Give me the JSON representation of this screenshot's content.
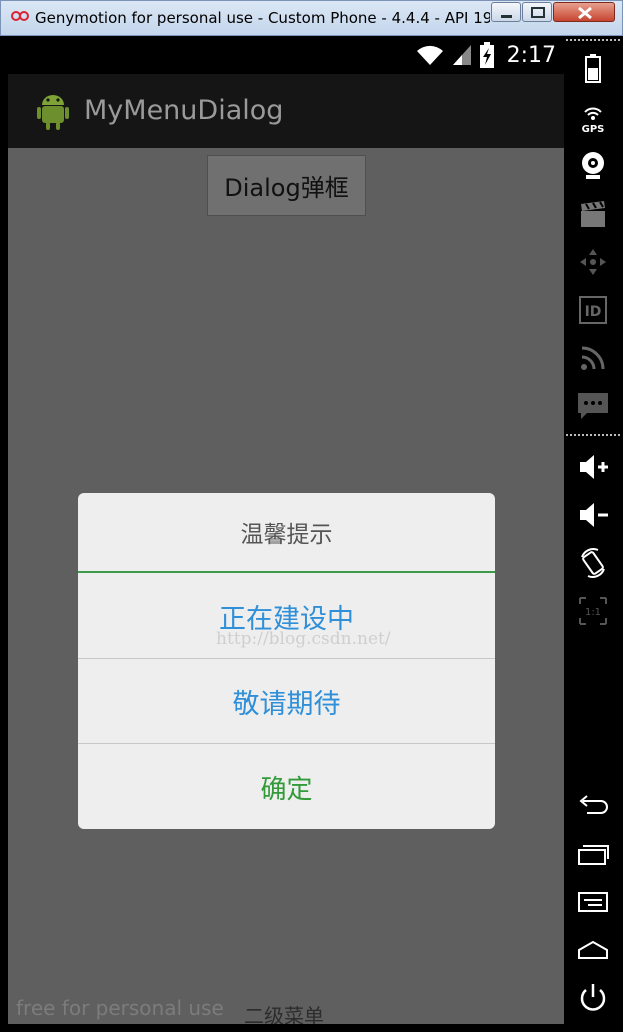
{
  "window": {
    "title": "Genymotion for personal use - Custom Phone - 4.4.4 - API 19 ..."
  },
  "status_bar": {
    "time": "2:17"
  },
  "app": {
    "title": "MyMenuDialog"
  },
  "content": {
    "trigger_button_label": "Dialog弹框",
    "bottom_hint": "free for personal use",
    "bottom_button_label": "二级菜单"
  },
  "dialog": {
    "title": "温馨提示",
    "items": [
      "正在建设中",
      "敬请期待"
    ],
    "confirm_label": "确定",
    "watermark": "http://blog.csdn.net/"
  },
  "colors": {
    "dialog_item_text": "#2f8fd8",
    "confirm_text": "#339a3a",
    "title_divider": "#3f9a4e"
  },
  "toolbar": {
    "scale_label": "1:1"
  }
}
